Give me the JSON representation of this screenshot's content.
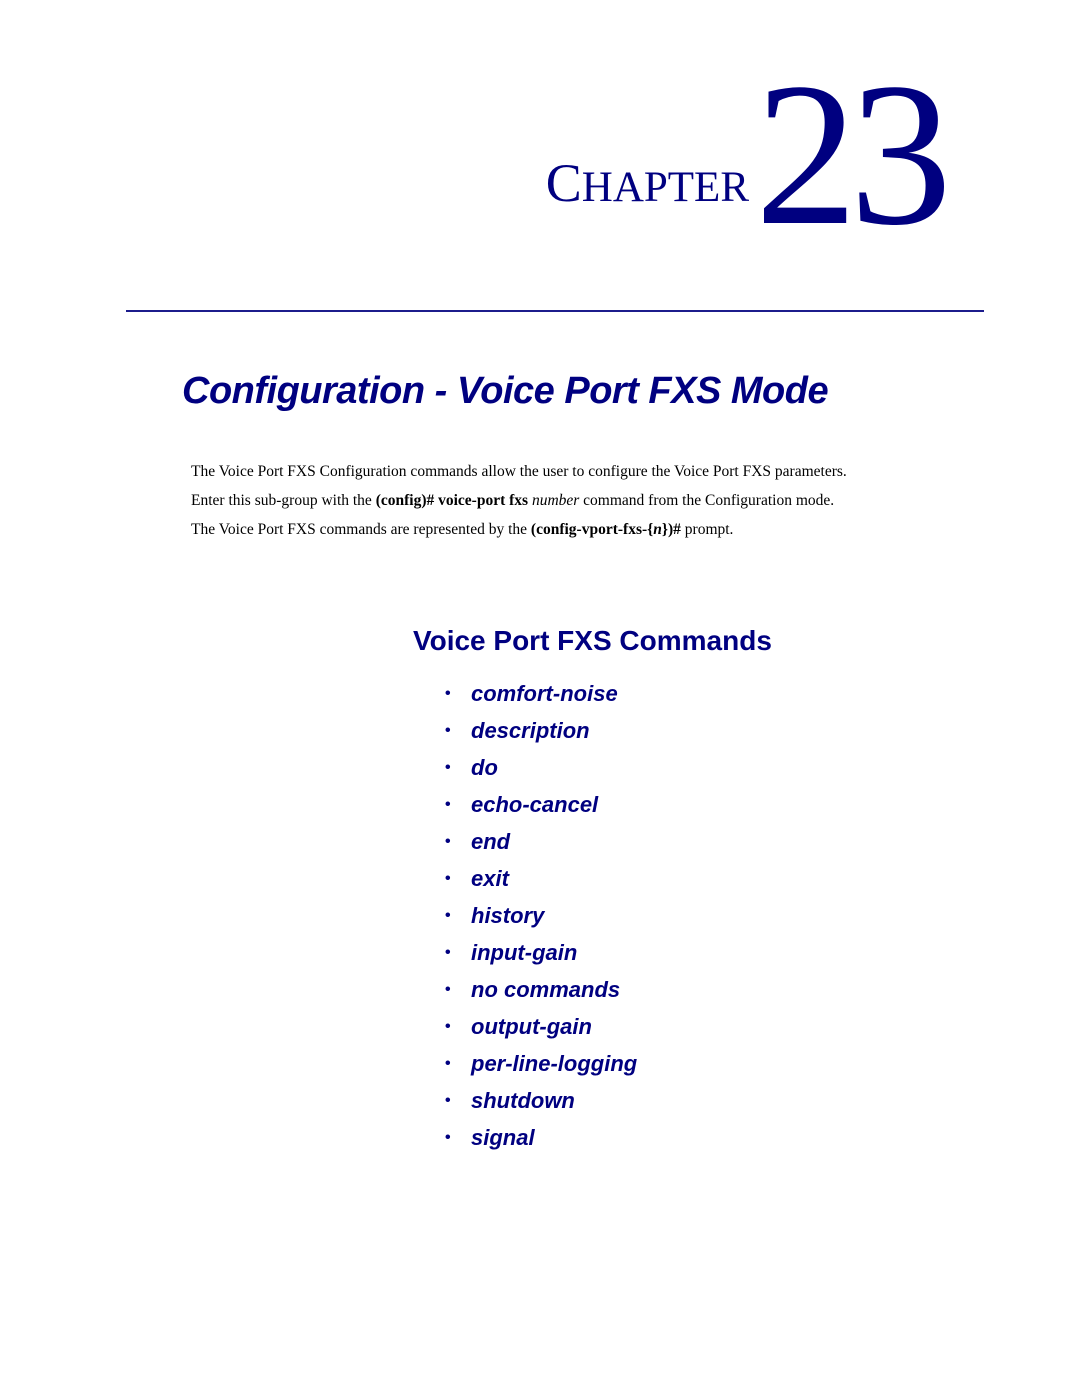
{
  "chapter": {
    "word_first": "C",
    "word_rest": "HAPTER",
    "number": "23"
  },
  "page_title": "Configuration - Voice Port FXS Mode",
  "intro": {
    "para1": "The Voice Port FXS Configuration commands allow the user to configure the Voice Port FXS parameters.",
    "para2": {
      "prefix": "Enter this sub-group with the ",
      "cmd_bold": "(config)# voice-port fxs",
      "space": " ",
      "arg_italic": "number",
      "suffix": " command from the Configuration mode."
    },
    "para3": {
      "prefix": "The Voice Port FXS commands are represented by the ",
      "prompt_bold_a": "(config-vport-fxs-{",
      "prompt_italic": "n",
      "prompt_bold_b": "})#",
      "suffix": " prompt."
    }
  },
  "section": {
    "heading": "Voice Port FXS Commands",
    "bullet_glyph": "•",
    "commands": [
      "comfort-noise",
      "description",
      "do",
      "echo-cancel",
      "end",
      "exit",
      "history",
      "input-gain",
      "no commands",
      "output-gain",
      "per-line-logging",
      "shutdown",
      "signal"
    ]
  },
  "colors": {
    "heading_navy": "#000080",
    "rule": "#1c1c8c",
    "body_text": "#000000"
  }
}
